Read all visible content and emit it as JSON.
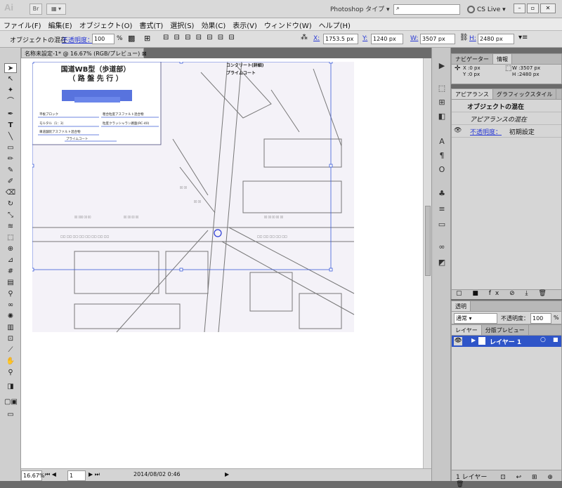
{
  "app": {
    "logo": "Ai",
    "bridge": "Br",
    "workspace": "Photoshop タイプ ▾",
    "cslive": "CS Live ▾"
  },
  "menu": [
    "ファイル(F)",
    "編集(E)",
    "オブジェクト(O)",
    "書式(T)",
    "選択(S)",
    "効果(C)",
    "表示(V)",
    "ウィンドウ(W)",
    "ヘルプ(H)"
  ],
  "control": {
    "label": "オブジェクトの混在",
    "opacity_label": "不透明度：",
    "opacity_value": "100",
    "percent": "%",
    "x_label": "X:",
    "x_value": "1753.5 px",
    "y_label": "Y:",
    "y_value": "1240 px",
    "w_label": "W:",
    "w_value": "3507 px",
    "h_label": "H:",
    "h_value": "2480 px"
  },
  "doc_tab": "名称未設定-1* @ 16.67% (RGB/プレビュー)",
  "map": {
    "title": "国道WB型（歩道部）",
    "subtitle": "（ 路 盤 先 行 ）",
    "labels_top": [
      "コンクリート(詳細)",
      "プライムコート"
    ],
    "layers": [
      "平板ブロック",
      "モルタル（1：3）",
      "車道舗装アスファルト混合物"
    ],
    "layers_right": [
      "粗合粒度アスファルト混合物",
      "粒度クラッシャラン路盤(RC-40)"
    ],
    "prime": "プライムコート"
  },
  "navigator": {
    "tabs": [
      "ナビゲーター",
      "情報"
    ],
    "x": "X  :0 px",
    "y": "Y  :0 px",
    "w": "W  :3507 px",
    "h": "H  :2480 px"
  },
  "appearance": {
    "tabs": [
      "アピアランス",
      "グラフィックスタイル"
    ],
    "title": "オブジェクトの混在",
    "mixed": "アピアランスの混在",
    "opacity_label": "不透明度：",
    "opacity_value": "初期設定"
  },
  "transparency": {
    "tab": "透明",
    "mode": "通常",
    "opacity_label": "不透明度：",
    "opacity_value": "100",
    "percent": "%"
  },
  "layers": {
    "tabs": [
      "レイヤー",
      "分版プレビュー"
    ],
    "layer_name": "レイヤー 1",
    "footer": "1 レイヤー"
  },
  "status": {
    "zoom": "16.67%",
    "page": "1",
    "datetime": "2014/08/02  0:46"
  },
  "colors": {
    "accent": "#2a3ad6",
    "selection": "#3b5bd8",
    "layer_row": "#2f55c8"
  }
}
